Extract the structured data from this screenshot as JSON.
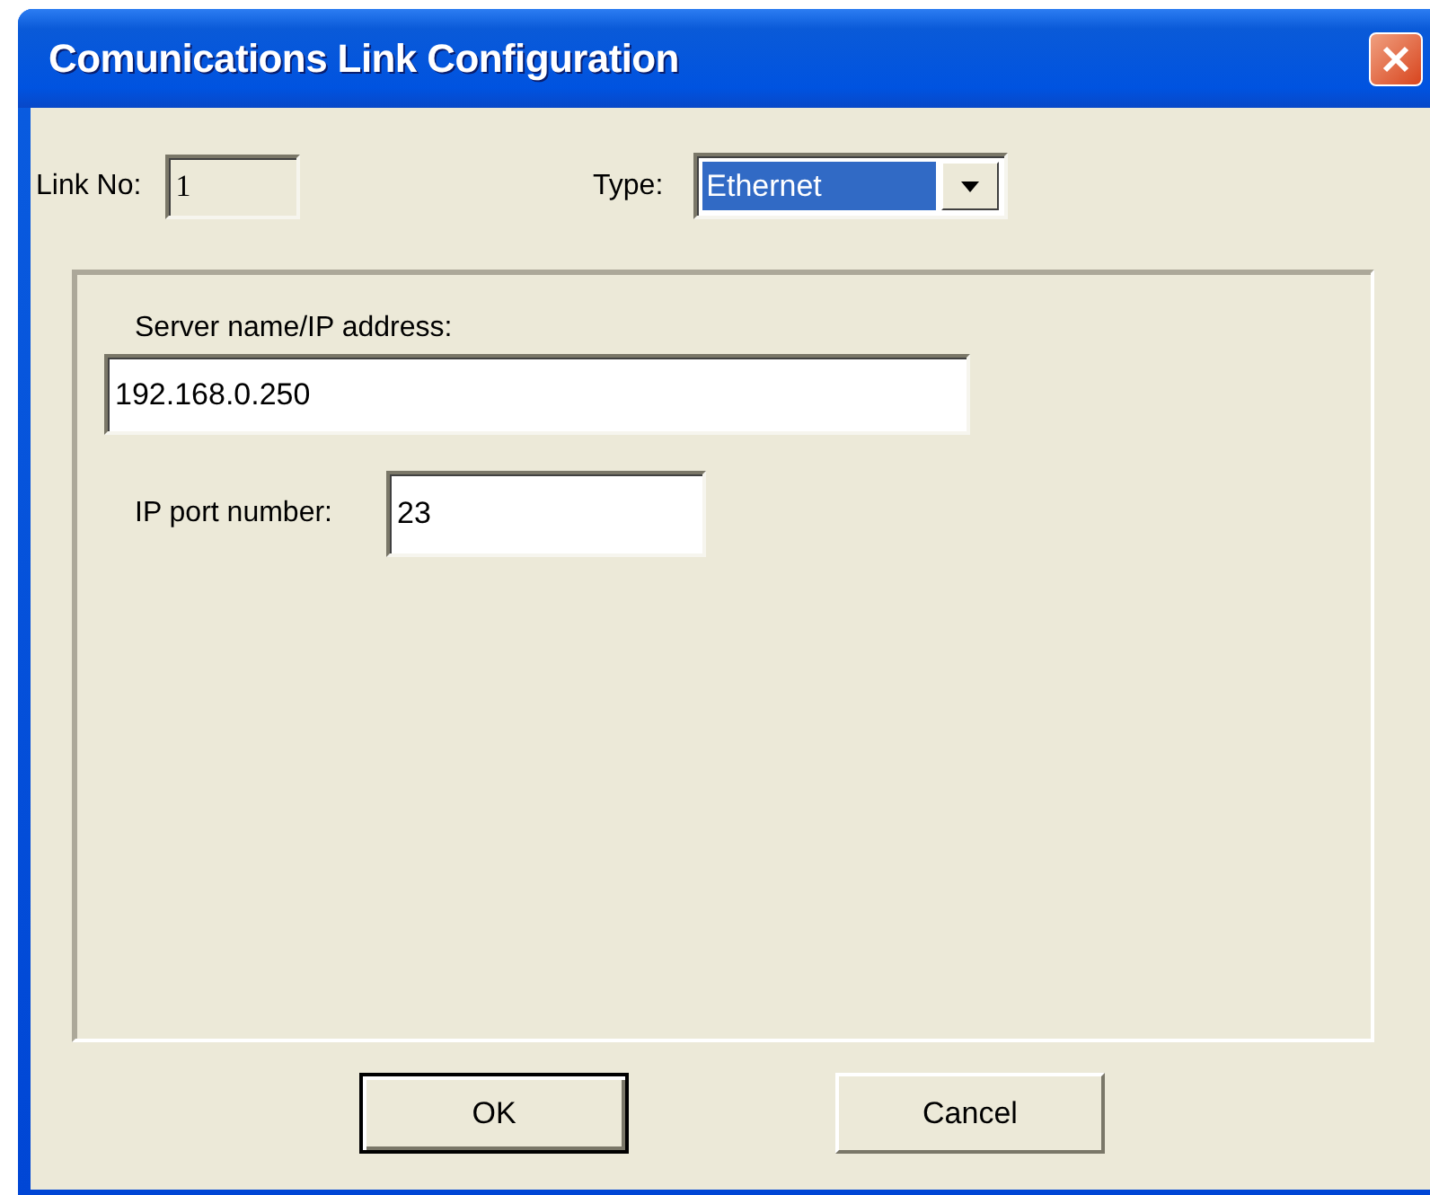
{
  "window": {
    "title": "Comunications Link Configuration"
  },
  "link_no": {
    "label": "Link No:",
    "value": "1",
    "disabled": true
  },
  "type": {
    "label": "Type:",
    "value": "Ethernet",
    "highlighted": true
  },
  "server": {
    "label": "Server name/IP address:",
    "value": "192.168.0.250"
  },
  "port": {
    "label": "IP port number:",
    "value": "23"
  },
  "buttons": [
    {
      "label": "OK",
      "default": true
    },
    {
      "label": "Cancel",
      "default": false
    }
  ]
}
